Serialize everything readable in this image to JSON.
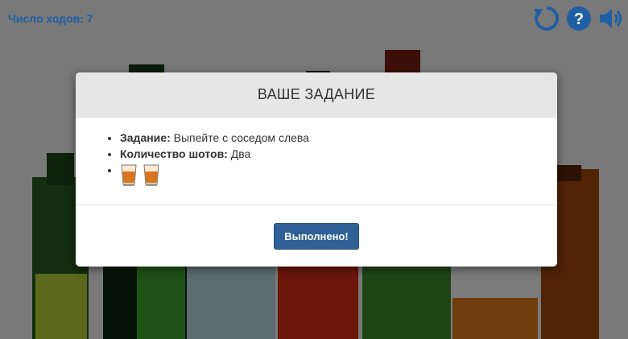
{
  "header": {
    "moves_label": "Число ходов:",
    "moves_count": "7",
    "icons": [
      "restart-icon",
      "help-icon",
      "sound-icon"
    ]
  },
  "modal": {
    "title": "ВАШЕ ЗАДАНИЕ",
    "task_label": "Задание:",
    "task_value": "Выпейте с соседом слева",
    "shots_label": "Количество шотов:",
    "shots_value": "Два",
    "shot_count": 2,
    "button_label": "Выполнено!"
  },
  "colors": {
    "accent": "#1f5fa3",
    "button": "#2f6196",
    "modal_header": "#e6e6e6"
  }
}
